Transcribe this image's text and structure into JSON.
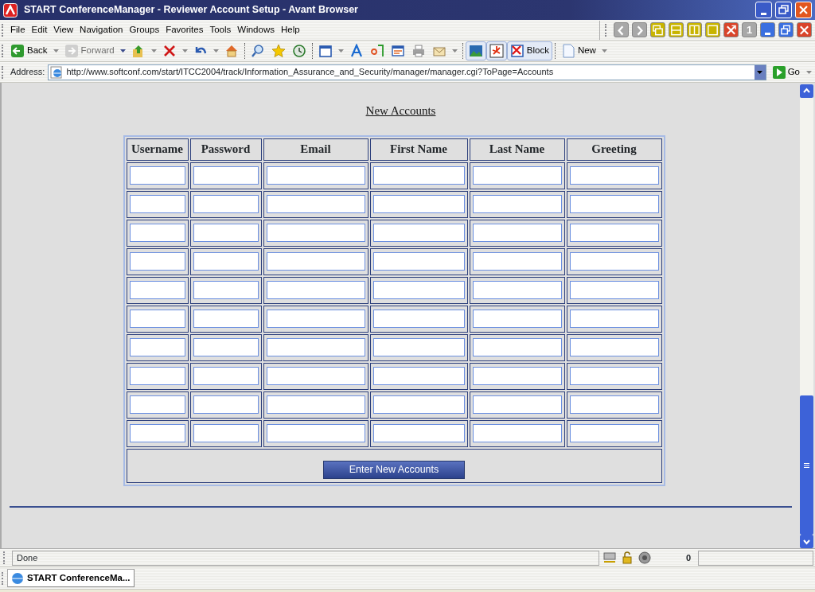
{
  "window": {
    "title": "START ConferenceManager - Reviewer Account Setup - Avant Browser"
  },
  "menu": [
    "File",
    "Edit",
    "View",
    "Navigation",
    "Groups",
    "Favorites",
    "Tools",
    "Windows",
    "Help"
  ],
  "tab_tools": [
    {
      "kind": "prev"
    },
    {
      "kind": "next"
    },
    {
      "kind": "cascade"
    },
    {
      "kind": "horizontal"
    },
    {
      "kind": "vertical"
    },
    {
      "kind": "single"
    },
    {
      "kind": "close-all"
    },
    {
      "kind": "number",
      "label": "1"
    },
    {
      "kind": "minimize"
    },
    {
      "kind": "restore"
    },
    {
      "kind": "close"
    }
  ],
  "toolbar": [
    {
      "kind": "back",
      "label": "Back",
      "disabled": false
    },
    {
      "kind": "forward",
      "label": "Forward",
      "disabled": true
    },
    {
      "kind": "up"
    },
    {
      "kind": "stop"
    },
    {
      "kind": "undo"
    },
    {
      "kind": "home"
    },
    {
      "kind": "sep"
    },
    {
      "kind": "search"
    },
    {
      "kind": "star"
    },
    {
      "kind": "history"
    },
    {
      "kind": "sep"
    },
    {
      "kind": "window"
    },
    {
      "kind": "font"
    },
    {
      "kind": "translate"
    },
    {
      "kind": "edit"
    },
    {
      "kind": "print"
    },
    {
      "kind": "mail"
    },
    {
      "kind": "sep"
    },
    {
      "kind": "image",
      "pressed": true
    },
    {
      "kind": "flash",
      "pressed": true
    },
    {
      "kind": "block",
      "label": "Block",
      "pressed": true
    },
    {
      "kind": "sep"
    },
    {
      "kind": "new",
      "label": "New"
    }
  ],
  "address": {
    "label": "Address:",
    "url": "http://www.softconf.com/start/ITCC2004/track/Information_Assurance_and_Security/manager/manager.cgi?ToPage=Accounts",
    "go": "Go"
  },
  "page": {
    "heading": "New Accounts",
    "table": {
      "columns": [
        "Username",
        "Password",
        "Email",
        "First Name",
        "Last Name",
        "Greeting"
      ],
      "rows": [
        {
          "kind": "blank"
        },
        {
          "kind": "blank"
        },
        {
          "kind": "blank"
        },
        {
          "kind": "blank"
        },
        {
          "kind": "blank"
        },
        {
          "kind": "blank"
        },
        {
          "kind": "blank"
        },
        {
          "kind": "blank"
        },
        {
          "kind": "blank"
        },
        {
          "kind": "blank"
        }
      ]
    },
    "button": "Enter New Accounts"
  },
  "status_bar": {
    "text": "Done",
    "count": "0"
  },
  "taskbar": [
    {
      "label": "START ConferenceMa...",
      "selected": true
    }
  ]
}
